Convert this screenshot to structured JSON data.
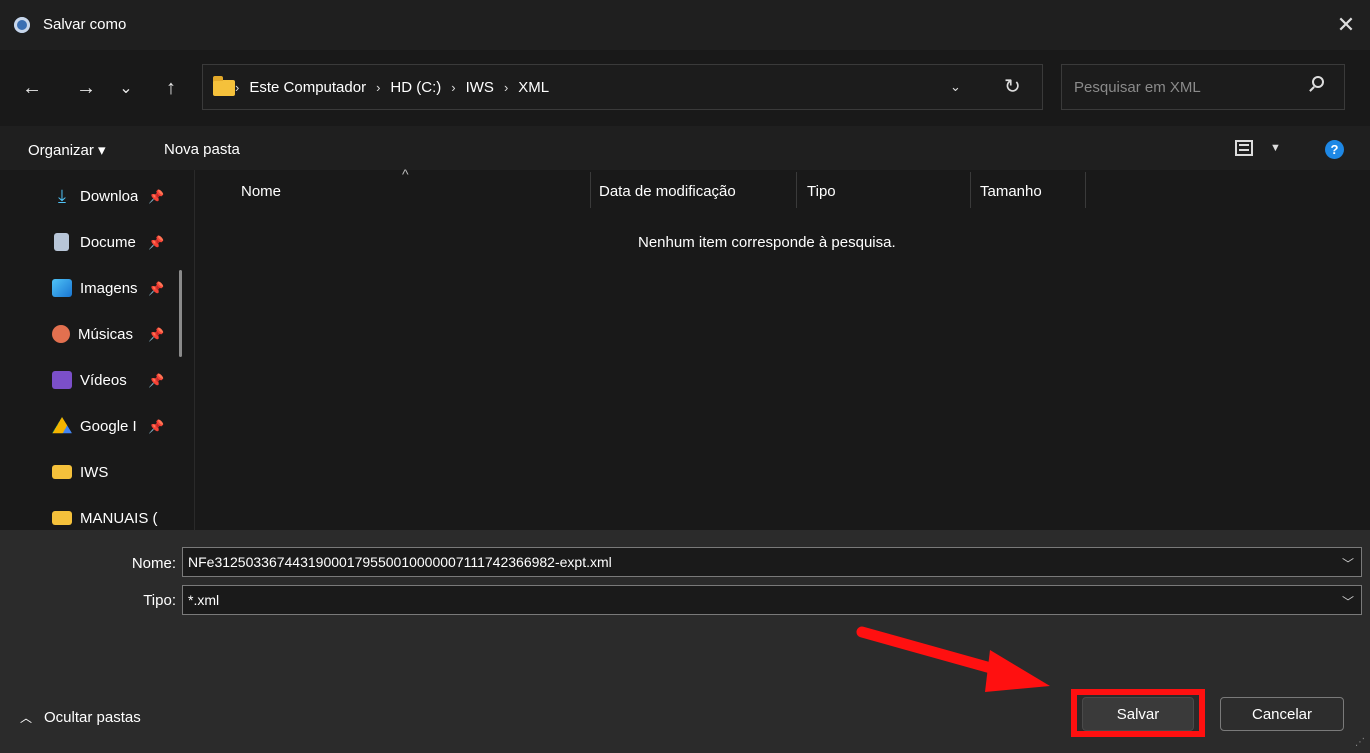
{
  "window": {
    "title": "Salvar como"
  },
  "nav": {
    "back": "←",
    "forward": "→",
    "recent": "⌄",
    "up": "↑",
    "breadcrumbs": [
      "Este Computador",
      "HD (C:)",
      "IWS",
      "XML"
    ],
    "search_placeholder": "Pesquisar em XML"
  },
  "toolbar": {
    "organize": "Organizar ▾",
    "new_folder": "Nova pasta"
  },
  "sidebar": {
    "items": [
      {
        "label": "Downloa",
        "icon": "download-icon"
      },
      {
        "label": "Docume",
        "icon": "document-icon"
      },
      {
        "label": "Imagens",
        "icon": "image-icon"
      },
      {
        "label": "Músicas",
        "icon": "music-icon"
      },
      {
        "label": "Vídeos",
        "icon": "video-icon"
      },
      {
        "label": "Google I",
        "icon": "google-drive-icon"
      },
      {
        "label": "IWS",
        "icon": "folder-icon"
      },
      {
        "label": "MANUAIS (",
        "icon": "folder-icon"
      }
    ]
  },
  "filelist": {
    "columns": [
      "Nome",
      "Data de modificação",
      "Tipo",
      "Tamanho"
    ],
    "empty_message": "Nenhum item corresponde à pesquisa."
  },
  "form": {
    "name_label": "Nome:",
    "name_value": "NFe31250336744319000179550010000007111742366982-expt.xml",
    "type_label": "Tipo:",
    "type_value": "*.xml"
  },
  "footer": {
    "hide_folders": "Ocultar pastas",
    "save": "Salvar",
    "cancel": "Cancelar"
  },
  "colors": {
    "highlight": "#ff1010",
    "arrow": "#ff1010",
    "help": "#1e88e5"
  }
}
